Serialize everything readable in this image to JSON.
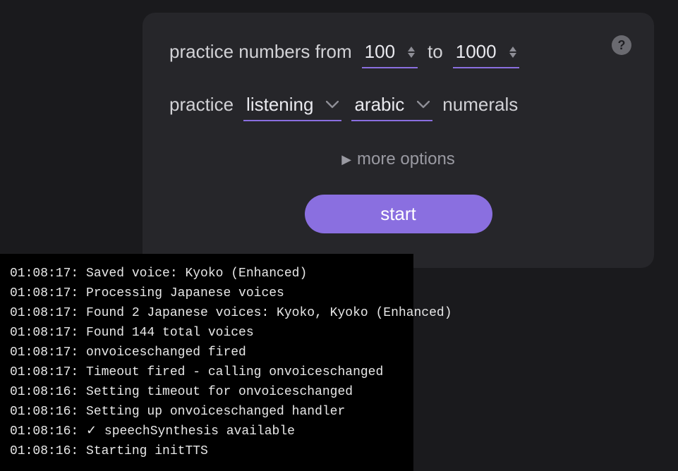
{
  "form": {
    "practice_numbers_label": "practice numbers from",
    "from_value": "100",
    "to_label": "to",
    "to_value": "1000",
    "practice_label": "practice",
    "mode_value": "listening",
    "script_value": "arabic",
    "numerals_label": "numerals",
    "more_options_label": "more options",
    "start_label": "start"
  },
  "help": {
    "glyph": "?"
  },
  "console": {
    "lines": [
      "01:08:17: Saved voice: Kyoko (Enhanced)",
      "01:08:17: Processing Japanese voices",
      "01:08:17: Found 2 Japanese voices: Kyoko, Kyoko (Enhanced)",
      "01:08:17: Found 144 total voices",
      "01:08:17: onvoiceschanged fired",
      "01:08:17: Timeout fired - calling onvoiceschanged",
      "01:08:16: Setting timeout for onvoiceschanged",
      "01:08:16: Setting up onvoiceschanged handler",
      "01:08:16: ✓ speechSynthesis available",
      "01:08:16: Starting initTTS"
    ]
  }
}
